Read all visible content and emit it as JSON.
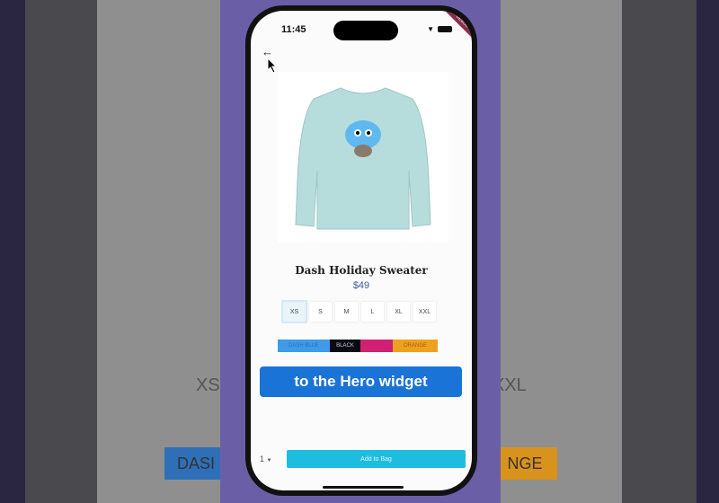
{
  "status_bar": {
    "time": "11:45",
    "banner": "DEBUG"
  },
  "product": {
    "title": "Dash Holiday Sweater",
    "price": "$49"
  },
  "sizes": [
    "XS",
    "S",
    "M",
    "L",
    "XL",
    "XXL"
  ],
  "selected_size": "XS",
  "colors": [
    {
      "label": "DASH BLUE",
      "color": "#3d9be9",
      "text": "#2a6cc0"
    },
    {
      "label": "BLACK",
      "color": "#0a0a12",
      "text": "#ccc"
    },
    {
      "label": "",
      "color": "#d02070",
      "text": "#fff"
    },
    {
      "label": "ORANGE",
      "color": "#f0a020",
      "text": "#a06010"
    }
  ],
  "overlay_caption": "to the Hero widget",
  "quantity": "1",
  "add_button": "Add to Bag",
  "background": {
    "size_left": "XS",
    "size_right": "XXL",
    "btn_left": "DASI",
    "btn_right": "NGE"
  }
}
